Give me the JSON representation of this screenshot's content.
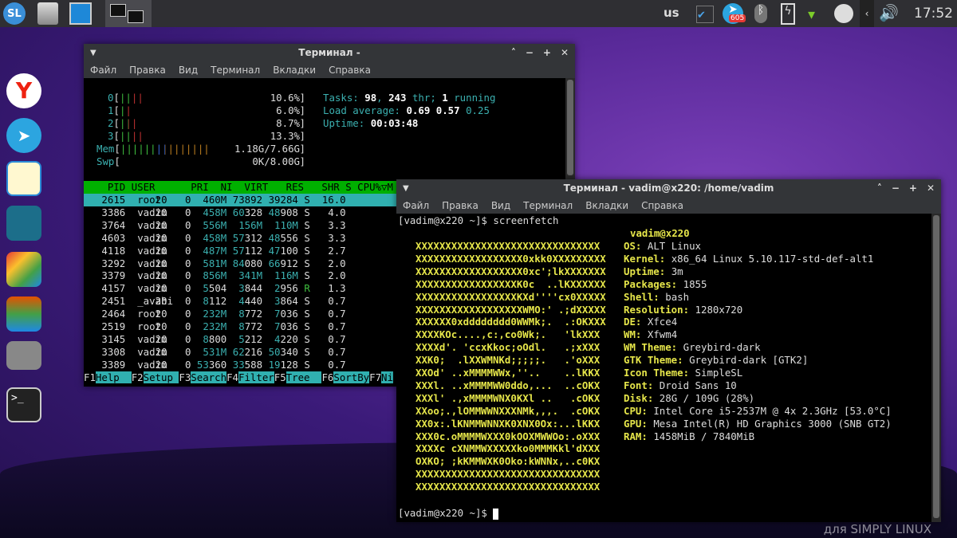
{
  "panel": {
    "keyboard_layout": "us",
    "clock": "17:52",
    "telegram_badge": "605",
    "left_icons": [
      "simplylinux-logo-icon",
      "file-manager-icon",
      "window-icon",
      "terminal-task-icon"
    ],
    "tray_icons": [
      "clipboard-icon",
      "telegram-icon",
      "bluetooth-icon",
      "battery-icon",
      "wifi-icon",
      "steam-icon",
      "chevron-left-icon",
      "volume-icon"
    ]
  },
  "dock": [
    "yandex-browser-icon",
    "telegram-icon",
    "notes-icon",
    "window-manager-icon",
    "office-icon",
    "layers-icon",
    "network-icon",
    "terminal-icon"
  ],
  "watermark": "для SIMPLY LINUX",
  "colors": {
    "htop_header": "#00b000",
    "htop_selected": "#30b0b0",
    "ascii_yellow": "#e6e64a"
  },
  "htop_window": {
    "title": "Терминал -",
    "menu": [
      "Файл",
      "Правка",
      "Вид",
      "Терминал",
      "Вкладки",
      "Справка"
    ],
    "cpus": [
      {
        "n": "0",
        "bars": "||||",
        "pct": "10.6%"
      },
      {
        "n": "1",
        "bars": "||",
        "pct": "6.0%"
      },
      {
        "n": "2",
        "bars": "|||",
        "pct": "8.7%"
      },
      {
        "n": "3",
        "bars": "||||",
        "pct": "13.3%"
      }
    ],
    "mem": {
      "bars": "|||||||||||||||",
      "value": "1.18G/7.66G"
    },
    "swp": {
      "value": "0K/8.00G"
    },
    "tasks_label": "Tasks:",
    "tasks": "98",
    "thr": "243",
    "thr_label": "thr;",
    "running": "1",
    "running_label": "running",
    "load_label": "Load average:",
    "load": [
      "0.69",
      "0.57",
      "0.25"
    ],
    "uptime_label": "Uptime:",
    "uptime": "00:03:48",
    "header": "    PID USER      PRI  NI  VIRT   RES   SHR S CPU%▽M",
    "rows": [
      [
        "2615",
        "root",
        "20",
        "0",
        "460M",
        "73892",
        "39284",
        "S",
        "16.0"
      ],
      [
        "3386",
        "vadim",
        "20",
        "0",
        "458M",
        "60328",
        "48908",
        "S",
        "4.0"
      ],
      [
        "3764",
        "vadim",
        "20",
        "0",
        "556M",
        "156M",
        "110M",
        "S",
        "3.3"
      ],
      [
        "4603",
        "vadim",
        "20",
        "0",
        "458M",
        "57312",
        "48556",
        "S",
        "3.3"
      ],
      [
        "4118",
        "vadim",
        "20",
        "0",
        "487M",
        "57112",
        "47100",
        "S",
        "2.7"
      ],
      [
        "3292",
        "vadim",
        "20",
        "0",
        "581M",
        "84080",
        "66912",
        "S",
        "2.0"
      ],
      [
        "3379",
        "vadim",
        "20",
        "0",
        "856M",
        "341M",
        "116M",
        "S",
        "2.0"
      ],
      [
        "4157",
        "vadim",
        "20",
        "0",
        "5504",
        "3844",
        "2956",
        "R",
        "1.3"
      ],
      [
        "2451",
        "_avahi",
        "20",
        "0",
        "8112",
        "4440",
        "3864",
        "S",
        "0.7"
      ],
      [
        "2464",
        "root",
        "20",
        "0",
        "232M",
        "8772",
        "7036",
        "S",
        "0.7"
      ],
      [
        "2519",
        "root",
        "20",
        "0",
        "232M",
        "8772",
        "7036",
        "S",
        "0.7"
      ],
      [
        "3145",
        "vadim",
        "20",
        "0",
        "8800",
        "5212",
        "4220",
        "S",
        "0.7"
      ],
      [
        "3308",
        "vadim",
        "20",
        "0",
        "531M",
        "62216",
        "50340",
        "S",
        "0.7"
      ],
      [
        "3389",
        "vadim",
        "20",
        "0",
        "53360",
        "33588",
        "19128",
        "S",
        "0.7"
      ]
    ],
    "fkeys": [
      [
        "F1",
        "Help  "
      ],
      [
        "F2",
        "Setup "
      ],
      [
        "F3",
        "Search"
      ],
      [
        "F4",
        "Filter"
      ],
      [
        "F5",
        "Tree  "
      ],
      [
        "F6",
        "SortBy"
      ],
      [
        "F7",
        "Ni"
      ]
    ]
  },
  "sf_window": {
    "title": "Терминал - vadim@x220: /home/vadim",
    "menu": [
      "Файл",
      "Правка",
      "Вид",
      "Терминал",
      "Вкладки",
      "Справка"
    ],
    "command_line": "[vadim@x220 ~]$ screenfetch",
    "user_host": "vadim@x220",
    "ascii": [
      "XXXXXXXXXXXXXXXXXXXXXXXXXXXXXXX",
      "XXXXXXXXXXXXXXXXXX0xkk0XXXXXXXXX",
      "XXXXXXXXXXXXXXXXXX0xc';lkXXXXXXX",
      "XXXXXXXXXXXXXXXXXK0c  ..lKXXXXXX",
      "XXXXXXXXXXXXXXXXXKXd''''cx0XXXXX",
      "XXXXXXXXXXXXXXXXXXWMO:' .;dXXXXX",
      "XXXXXX0xdddddddd0WWMk;.  .:OKXXX",
      "XXXXKOc....,c:,co0Wk;.   'lkXXX",
      "XXXXd'. 'ccxKkoc;oOdl.   .;xXXX",
      "XXK0;  .lXXWMNKd;;;;;.   .'oXXX",
      "XXOd' ..xMMMMWWx,''..    ..lKKX",
      "XXXl. ..xMMMMWW0ddo,...  ..cOKX",
      "XXXl' .,xMMMMWNX0KXl ..   .cOKX",
      "XXoo;.,lOMMWWNXXXNMk,,,.  .cOKX",
      "XX0x:.lKNMMWNNXK0XNX0Ox:...lKKX",
      "XXX0c.oMMMMWXXX0kOOXMWWOo:.oXXX",
      "XXXXc cXNMMWXXXXXko0MMMKkl'dXXX",
      "OXKO; ;kKMMWXK0Oko:kWNNx,..c0KX",
      "XXXXXXXXXXXXXXXXXXXXXXXXXXXXXXX",
      "XXXXXXXXXXXXXXXXXXXXXXXXXXXXXXX"
    ],
    "info": [
      [
        "OS:",
        "ALT Linux"
      ],
      [
        "Kernel:",
        "x86_64 Linux 5.10.117-std-def-alt1"
      ],
      [
        "Uptime:",
        "3m"
      ],
      [
        "Packages:",
        "1855"
      ],
      [
        "Shell:",
        "bash"
      ],
      [
        "Resolution:",
        "1280x720"
      ],
      [
        "DE:",
        "Xfce4"
      ],
      [
        "WM:",
        "Xfwm4"
      ],
      [
        "WM Theme:",
        "Greybird-dark"
      ],
      [
        "GTK Theme:",
        "Greybird-dark [GTK2]"
      ],
      [
        "Icon Theme:",
        "SimpleSL"
      ],
      [
        "Font:",
        "Droid Sans 10"
      ],
      [
        "Disk:",
        "28G / 109G (28%)"
      ],
      [
        "CPU:",
        "Intel Core i5-2537M @ 4x 2.3GHz [53.0°C]"
      ],
      [
        "GPU:",
        "Mesa Intel(R) HD Graphics 3000 (SNB GT2)"
      ],
      [
        "RAM:",
        "1458MiB / 7840MiB"
      ]
    ],
    "prompt": "[vadim@x220 ~]$ "
  }
}
